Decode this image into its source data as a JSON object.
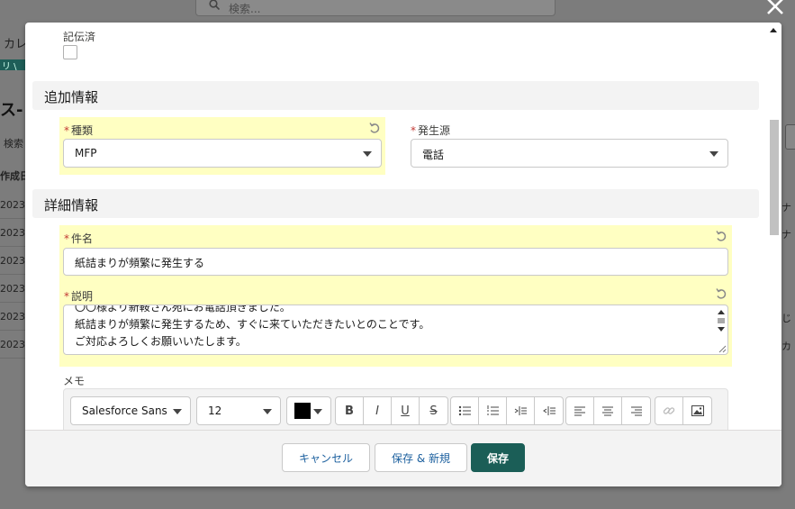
{
  "background": {
    "search_placeholder": "検索...",
    "tab_label": "カレ",
    "band_text": "リ \\",
    "heading": "ス-!",
    "search_label": "検索",
    "column_header": "作成日",
    "rows": [
      "2023/0",
      "2023/0",
      "2023/0",
      "2023/0",
      "2023/0",
      "2023/0"
    ],
    "right_texts": [
      "ナ",
      "ナ",
      "じ",
      "カ"
    ]
  },
  "modal": {
    "checkbox_label": "記伝済",
    "section_additional": "追加情報",
    "type_field": {
      "label": "種類",
      "value": "MFP"
    },
    "origin_field": {
      "label": "発生源",
      "value": "電話"
    },
    "section_detail": "詳細情報",
    "subject_field": {
      "label": "件名",
      "value": "紙詰まりが頻繁に発生する"
    },
    "description_field": {
      "label": "説明",
      "lines": [
        "〇〇様より新鞍さん宛にお電話頂きました。",
        "紙詰まりが頻繁に発生するため、すぐに来ていただきたいとのことです。",
        "ご対応よろしくお願いいたします。"
      ]
    },
    "memo_label": "メモ",
    "editor": {
      "font_family": "Salesforce Sans",
      "font_size": "12",
      "text_color": "#000000"
    },
    "footer": {
      "cancel_label": "キャンセル",
      "save_new_label": "保存 & 新規",
      "save_label": "保存"
    }
  },
  "colors": {
    "highlight": "#ffffc2",
    "brand": "#1b5e57",
    "required": "#c23934"
  }
}
